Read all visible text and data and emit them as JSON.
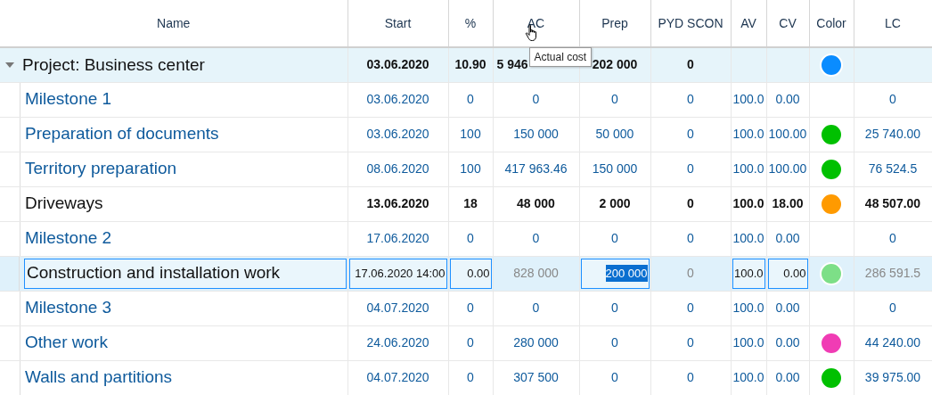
{
  "columns": [
    {
      "label": "Name",
      "kind": "name",
      "editable": true,
      "focused": false
    },
    {
      "label": "Start",
      "kind": "text",
      "editable": true,
      "focused": false
    },
    {
      "label": "%",
      "kind": "text",
      "editable": true,
      "focused": false
    },
    {
      "label": "AC",
      "kind": "text",
      "editable": false,
      "tooltip": "Actual cost",
      "hovered": true
    },
    {
      "label": "Prep",
      "kind": "text",
      "editable": true,
      "focused": true
    },
    {
      "label": "PYD SCON",
      "kind": "text",
      "editable": false
    },
    {
      "label": "AV",
      "kind": "text",
      "editable": true,
      "focused": false
    },
    {
      "label": "CV",
      "kind": "text",
      "editable": true,
      "focused": false
    },
    {
      "label": "Color",
      "kind": "color"
    },
    {
      "label": "LC",
      "kind": "text",
      "editable": false
    }
  ],
  "rows": [
    {
      "kind": "project",
      "name": "Project: Business center",
      "expanded": true,
      "selected": false,
      "color": "#0a8cff",
      "cells": [
        "03.06.2020",
        "10.90",
        "5 946",
        "202 000",
        "0",
        null,
        null,
        null
      ],
      "children": [
        {
          "kind": "task",
          "name": "Milestone 1",
          "selected": false,
          "cells": [
            "03.06.2020",
            "0",
            "0",
            "0",
            "0",
            "100.0",
            "0.00",
            "0"
          ]
        },
        {
          "kind": "task",
          "name": "Preparation of documents",
          "selected": false,
          "color": "#00c000",
          "cells": [
            "03.06.2020",
            "100",
            "150 000",
            "50 000",
            "0",
            "100.0",
            "100.00",
            "25 740.00"
          ]
        },
        {
          "kind": "task",
          "name": "Territory preparation",
          "selected": false,
          "color": "#00c000",
          "cells": [
            "08.06.2020",
            "100",
            "417 963.46",
            "150 000",
            "0",
            "100.0",
            "100.00",
            "76 524.5"
          ]
        },
        {
          "kind": "group",
          "name": "Driveways",
          "selected": false,
          "color": "#ff9a00",
          "cells": [
            "13.06.2020",
            "18",
            "48 000",
            "2 000",
            "0",
            "100.0",
            "18.00",
            "48 507.00"
          ]
        },
        {
          "kind": "task",
          "name": "Milestone 2",
          "selected": false,
          "cells": [
            "17.06.2020",
            "0",
            "0",
            "0",
            "0",
            "100.0",
            "0.00",
            "0"
          ]
        },
        {
          "kind": "group",
          "name": "Construction and installation work",
          "selected": true,
          "color": "#7ddf87",
          "cells": [
            "17.06.2020 14:00",
            "0.00",
            "828 000",
            "200 000",
            "0",
            "100.0",
            "0.00",
            "286 591.5"
          ]
        },
        {
          "kind": "task",
          "name": "Milestone 3",
          "selected": false,
          "cells": [
            "04.07.2020",
            "0",
            "0",
            "0",
            "0",
            "100.0",
            "0.00",
            "0"
          ]
        },
        {
          "kind": "task",
          "name": "Other work",
          "selected": false,
          "color": "#f03cb4",
          "cells": [
            "24.06.2020",
            "0",
            "280 000",
            "0",
            "0",
            "100.0",
            "0.00",
            "44 240.00"
          ]
        },
        {
          "kind": "task",
          "name": "Walls and partitions",
          "selected": false,
          "color": "#00c000",
          "cells": [
            "04.07.2020",
            "0",
            "307 500",
            "0",
            "0",
            "100.0",
            "0.00",
            "39 975.00"
          ]
        }
      ]
    }
  ]
}
